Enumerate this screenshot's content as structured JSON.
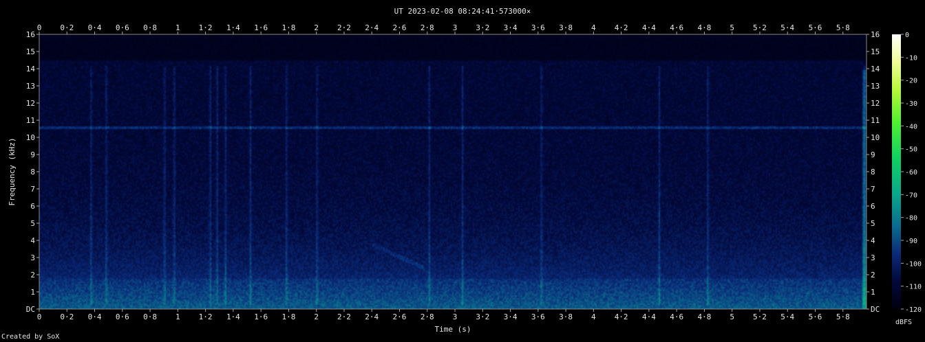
{
  "chart_data": {
    "type": "heatmap",
    "title": "UT 2023-02-08 08:24:41·573000×",
    "xlabel": "Time (s)",
    "ylabel": "Frequency (kHz)",
    "xlim": [
      0,
      5.97
    ],
    "ylim": [
      0,
      16
    ],
    "x_ticks": [
      "0",
      "0·2",
      "0·4",
      "0·6",
      "0·8",
      "1",
      "1·2",
      "1·4",
      "1·6",
      "1·8",
      "2",
      "2·2",
      "2·4",
      "2·6",
      "2·8",
      "3",
      "3·2",
      "3·4",
      "3·6",
      "3·8",
      "4",
      "4·2",
      "4·4",
      "4·6",
      "4·8",
      "5",
      "5·2",
      "5·4",
      "5·6",
      "5·8"
    ],
    "y_ticks": [
      "DC",
      "1",
      "2",
      "3",
      "4",
      "5",
      "6",
      "7",
      "8",
      "9",
      "10",
      "11",
      "12",
      "13",
      "14",
      "15",
      "16"
    ],
    "colorbar": {
      "label": "dBFS",
      "ticks": [
        "0",
        "-10",
        "-20",
        "-30",
        "-40",
        "-50",
        "-60",
        "-70",
        "-80",
        "-90",
        "-100",
        "-110",
        "-120"
      ],
      "range": [
        -120,
        0
      ]
    },
    "features": {
      "tone_khz": 10.6,
      "transients_s": [
        0.37,
        0.48,
        0.9,
        0.97,
        1.23,
        1.28,
        1.34,
        1.52,
        1.78,
        2.0,
        2.81,
        3.05,
        3.62,
        4.47,
        4.82,
        5.95
      ],
      "sweep": {
        "t0": 2.4,
        "f0": 3.8,
        "t1": 2.78,
        "f1": 2.4
      }
    }
  },
  "footer": "Created by SoX"
}
